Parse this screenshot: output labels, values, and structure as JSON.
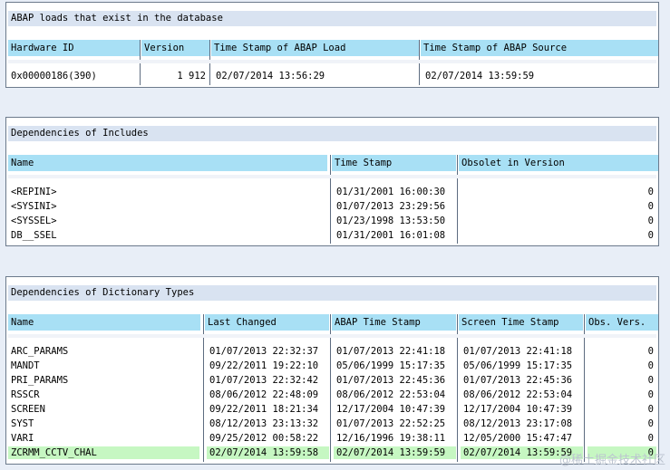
{
  "loads": {
    "title": "ABAP loads that exist in the database",
    "headers": [
      "Hardware ID",
      "Version",
      "Time Stamp of ABAP Load",
      "Time Stamp of ABAP Source"
    ],
    "row": [
      "0x00000186(390)",
      "1 912",
      "02/07/2014 13:56:29",
      "02/07/2014 13:59:59"
    ]
  },
  "includes": {
    "title": "Dependencies of Includes",
    "headers": [
      "Name",
      "Time Stamp",
      "Obsolet in Version"
    ],
    "rows": [
      [
        "<REPINI>",
        "01/31/2001 16:00:30",
        "0"
      ],
      [
        "<SYSINI>",
        "01/07/2013 23:29:56",
        "0"
      ],
      [
        "<SYSSEL>",
        "01/23/1998 13:53:50",
        "0"
      ],
      [
        "DB__SSEL",
        "01/31/2001 16:01:08",
        "0"
      ]
    ]
  },
  "dict": {
    "title": "Dependencies of Dictionary Types",
    "headers": [
      "Name",
      "Last Changed",
      "ABAP Time Stamp",
      "Screen Time Stamp",
      "Obs. Vers."
    ],
    "rows": [
      [
        "ARC_PARAMS",
        "01/07/2013 22:32:37",
        "01/07/2013 22:41:18",
        "01/07/2013 22:41:18",
        "0"
      ],
      [
        "MANDT",
        "09/22/2011 19:22:10",
        "05/06/1999 15:17:35",
        "05/06/1999 15:17:35",
        "0"
      ],
      [
        "PRI_PARAMS",
        "01/07/2013 22:32:42",
        "01/07/2013 22:45:36",
        "01/07/2013 22:45:36",
        "0"
      ],
      [
        "RSSCR",
        "08/06/2012 22:48:09",
        "08/06/2012 22:53:04",
        "08/06/2012 22:53:04",
        "0"
      ],
      [
        "SCREEN",
        "09/22/2011 18:21:34",
        "12/17/2004 10:47:39",
        "12/17/2004 10:47:39",
        "0"
      ],
      [
        "SYST",
        "08/12/2013 23:13:32",
        "01/07/2013 22:52:25",
        "08/12/2013 23:17:08",
        "0"
      ],
      [
        "VARI",
        "09/25/2012 00:58:22",
        "12/16/1996 19:38:11",
        "12/05/2000 15:47:47",
        "0"
      ],
      [
        "ZCRMM_CCTV_CHAL",
        "02/07/2014 13:59:58",
        "02/07/2014 13:59:59",
        "02/07/2014 13:59:59",
        "0"
      ]
    ],
    "highlight_row": 7
  },
  "watermark": "@稀土掘金技术社区",
  "colors": {
    "header_bg": "#a8e0f5",
    "title_bg": "#d9e3f1",
    "highlight": "#c6f7c2",
    "page_bg": "#e8eef7"
  }
}
